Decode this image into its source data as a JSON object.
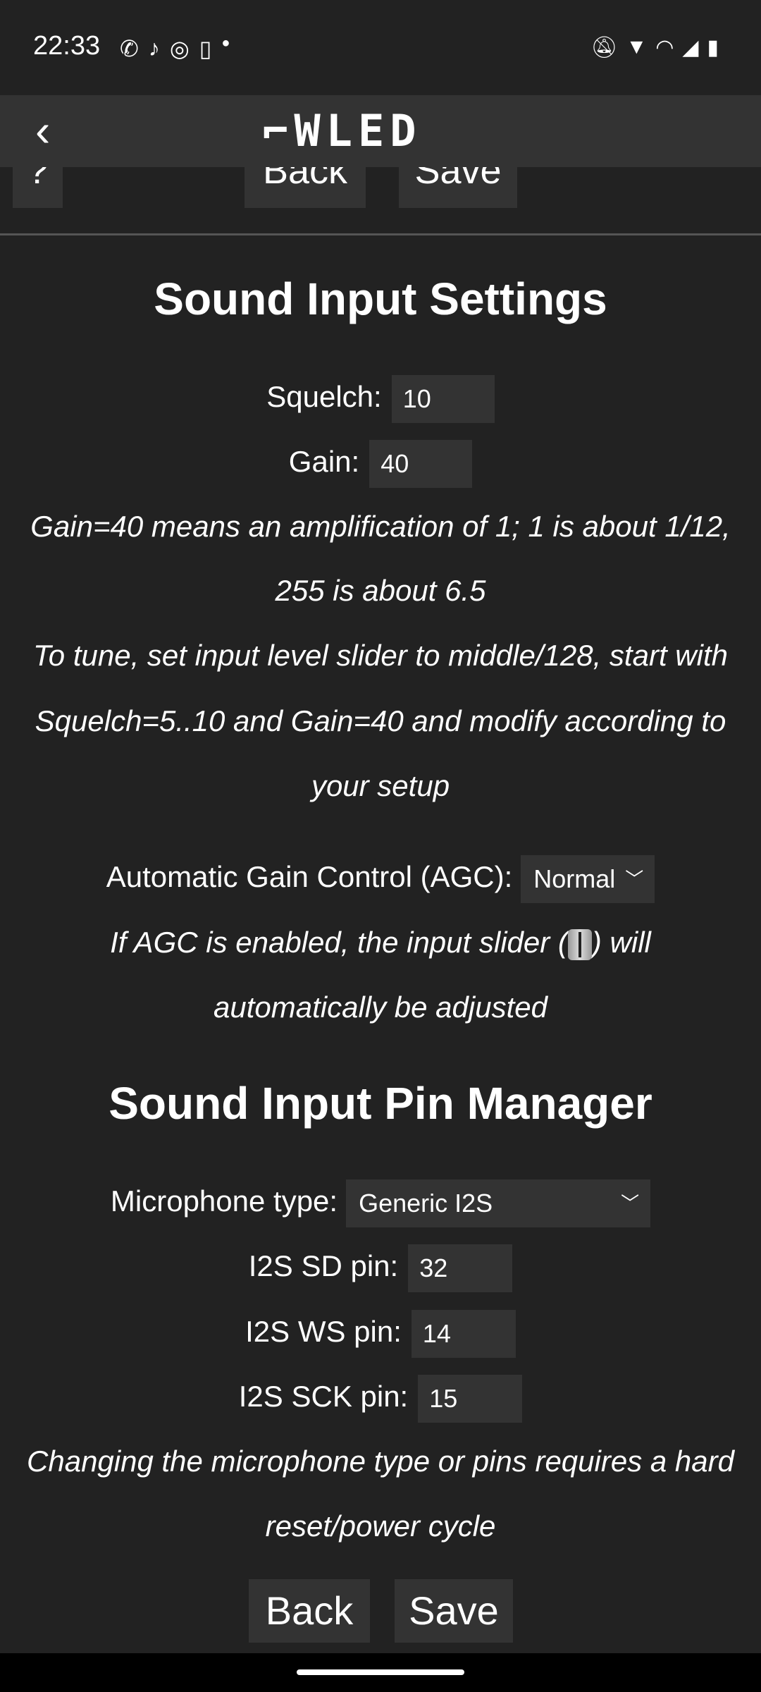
{
  "status_bar": {
    "time": "22:33",
    "notification_icons": [
      "whatsapp-icon",
      "tiktok-icon",
      "instagram-icon",
      "twitch-icon",
      "dot-icon"
    ],
    "system_icons": [
      "bell-off-icon",
      "wifi-icon",
      "hotspot-icon",
      "signal-icon",
      "battery-icon"
    ]
  },
  "app_bar": {
    "logo": "WLED"
  },
  "top_buttons": {
    "help": "?",
    "back": "Back",
    "save": "Save"
  },
  "settings": {
    "title": "Sound Input Settings",
    "squelch_label": "Squelch:",
    "squelch_value": "10",
    "gain_label": "Gain:",
    "gain_value": "40",
    "gain_note_1": "Gain=40 means an amplification of 1; 1 is about 1/12,",
    "gain_note_2": "255 is about 6.5",
    "tune_note_1": "To tune, set input level slider to middle/128, start with",
    "tune_note_2": "Squelch=5..10 and Gain=40 and modify according to",
    "tune_note_3": "your setup",
    "agc_label": "Automatic Gain Control (AGC):",
    "agc_value": "Normal",
    "agc_note_1a": "If AGC is enabled, the input slider (",
    "agc_note_1b": ") will",
    "agc_note_2": "automatically be adjusted"
  },
  "pins": {
    "title": "Sound Input Pin Manager",
    "mic_label": "Microphone type:",
    "mic_value": "Generic I2S",
    "sd_label": "I2S SD pin:",
    "sd_value": "32",
    "ws_label": "I2S WS pin:",
    "ws_value": "14",
    "sck_label": "I2S SCK pin:",
    "sck_value": "15",
    "note_1": "Changing the microphone type or pins requires a hard",
    "note_2": "reset/power cycle"
  },
  "bottom_buttons": {
    "back": "Back",
    "save": "Save"
  }
}
